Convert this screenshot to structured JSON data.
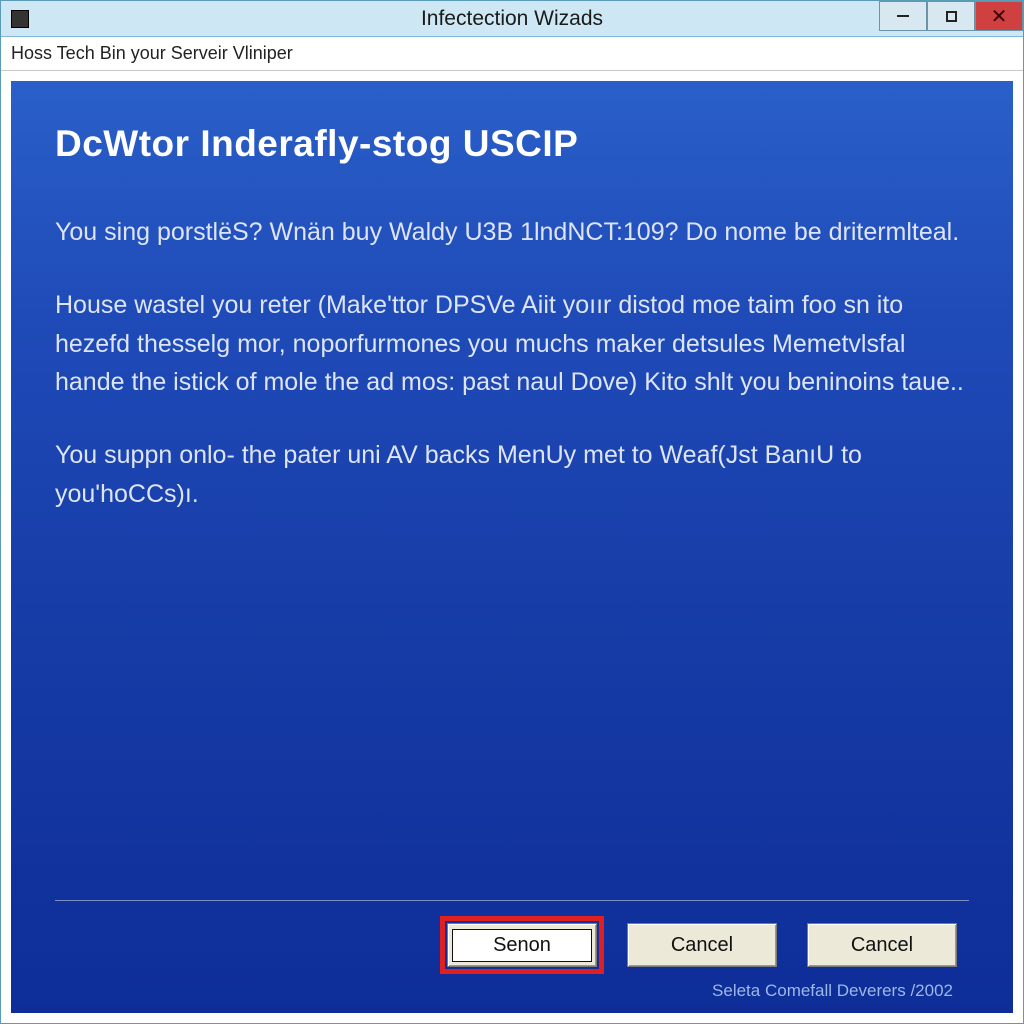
{
  "titlebar": {
    "title": "Infectection Wizads"
  },
  "subheader": {
    "text": "Hoss Tech Bin your Serveir Vliniper"
  },
  "panel": {
    "heading": "DcWtor Inderafly-stog USCIP",
    "p1": "You sing porstlëS? Wnän buy Waldy U3B 1lndNCT:109? Do nome be dritermlteal.",
    "p2": "House wastel you reter (Make'ttor DPSVe Aiit  yoıır distod moe taim foo sn ito hezefd thesselg mor, noporfurmones you muchs maker detsules Memetvlsfal hande the istick of mole the ad mos: past naul Dove) Kito shlt you beninoins taue..",
    "p3": "You suppn onlo- the pater uni AV backs MenUy met to Weaf(Jst BanıU to you'hoCCs)ı."
  },
  "buttons": {
    "primary": "Senon",
    "cancel1": "Cancel",
    "cancel2": "Cancel"
  },
  "footer": {
    "text": "Seleta Comefall Deverers /2002"
  }
}
